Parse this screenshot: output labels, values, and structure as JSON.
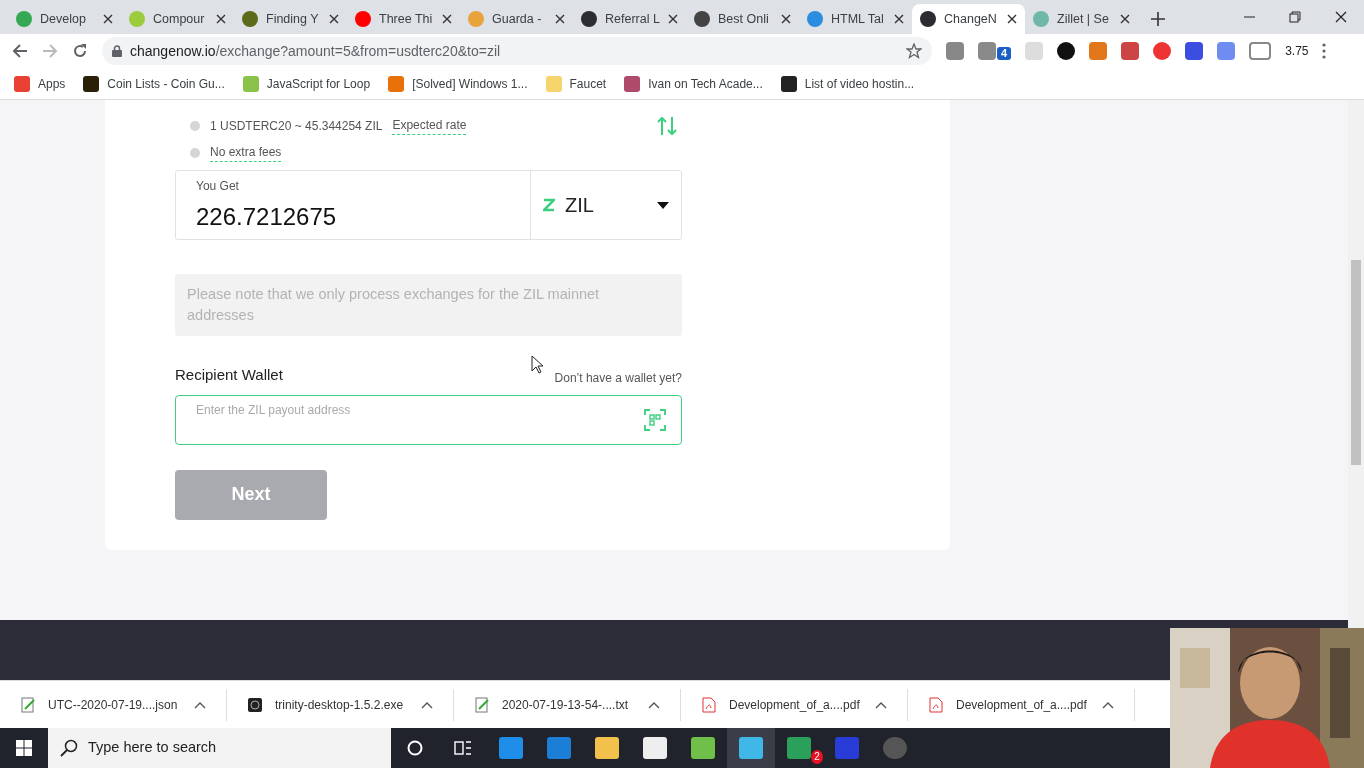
{
  "browser": {
    "tabs": [
      {
        "title": "Develop",
        "color": "#34a853",
        "selected": false
      },
      {
        "title": "Compour",
        "color": "#9ccc3c",
        "selected": false
      },
      {
        "title": "Finding Y",
        "color": "#5b6b1a",
        "selected": false
      },
      {
        "title": "Three Thi",
        "color": "#ff0000",
        "selected": false
      },
      {
        "title": "Guarda -",
        "color": "#e8a33d",
        "selected": false
      },
      {
        "title": "Referral L",
        "color": "#2b2d33",
        "selected": false
      },
      {
        "title": "Best Onli",
        "color": "#444444",
        "selected": false
      },
      {
        "title": "HTML Tal",
        "color": "#2a8de0",
        "selected": false
      },
      {
        "title": "ChangeN",
        "color": "#2b2d33",
        "selected": true
      },
      {
        "title": "Zillet | Se",
        "color": "#6fb8a8",
        "selected": false
      }
    ],
    "url_host": "changenow.io",
    "url_path": "/exchange?amount=5&from=usdterc20&to=zil",
    "extension_badge": "4",
    "extension_reading": "3.75"
  },
  "bookmarks": [
    {
      "label": "Apps",
      "color": "#e94235"
    },
    {
      "label": "Coin Lists - Coin Gu...",
      "color": "#2a2008"
    },
    {
      "label": "JavaScript for Loop",
      "color": "#8bc34a"
    },
    {
      "label": "[Solved] Windows 1...",
      "color": "#e8710a"
    },
    {
      "label": "Faucet",
      "color": "#f6d46b"
    },
    {
      "label": "Ivan on Tech Acade...",
      "color": "#b04a6a"
    },
    {
      "label": "List of video hostin...",
      "color": "#222222"
    }
  ],
  "exchange": {
    "rate": "1 USDTERC20 ~ 45.344254 ZIL",
    "rate_link": "Expected rate",
    "fees": "No extra fees",
    "get_label": "You Get",
    "get_amount": "226.7212675",
    "currency": "ZIL",
    "notice": "Please note that we only process exchanges for the ZIL mainnet addresses",
    "wallet_label": "Recipient Wallet",
    "wallet_help": "Don’t have a wallet yet?",
    "wallet_placeholder": "Enter the ZIL payout address",
    "next": "Next",
    "next_disabled": true
  },
  "downloads": [
    {
      "name": "UTC--2020-07-19....json",
      "kind": "text"
    },
    {
      "name": "trinity-desktop-1.5.2.exe",
      "kind": "app"
    },
    {
      "name": "2020-07-19-13-54-....txt",
      "kind": "text"
    },
    {
      "name": "Development_of_a....pdf",
      "kind": "pdf"
    },
    {
      "name": "Development_of_a....pdf",
      "kind": "pdf"
    }
  ],
  "taskbar": {
    "search_placeholder": "Type here to search",
    "chat_badge": "2"
  }
}
